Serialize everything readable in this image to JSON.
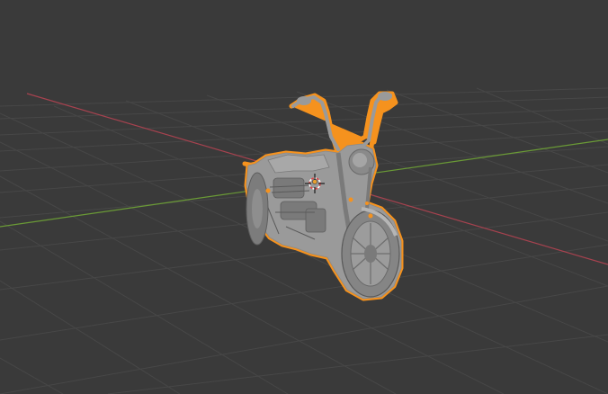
{
  "viewport": {
    "view": "3D Viewport",
    "background_color": "#3a3a3a",
    "grid_color": "#4a4a4a",
    "x_axis_color": "#a6424f",
    "y_axis_color": "#6a9a36"
  },
  "object": {
    "name": "",
    "selected": true,
    "outline_color": "#f5921e",
    "surface_color": "#9a9a9a",
    "shade_color": "#6a6a6a",
    "highlight_color": "#bdbdbd"
  },
  "origin_marker": {
    "icon": "origin-dot-icon",
    "color": "#e8a030"
  },
  "cursor_3d": {
    "icon": "3d-cursor-icon"
  }
}
